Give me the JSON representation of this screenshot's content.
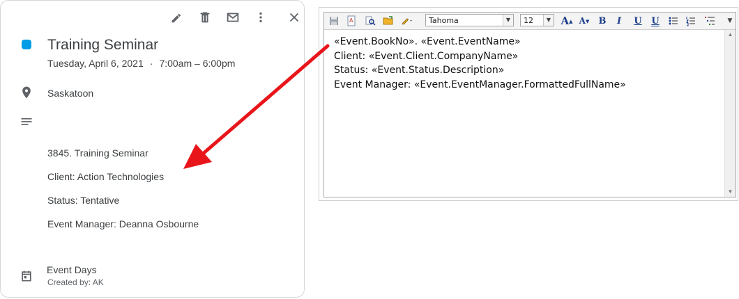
{
  "event": {
    "title": "Training Seminar",
    "date": "Tuesday, April 6, 2021",
    "separator": "·",
    "time": "7:00am – 6:00pm",
    "location": "Saskatoon",
    "color": "#039be5",
    "description": [
      "3845. Training Seminar",
      "Client: Action Technologies",
      "Status: Tentative",
      "Event Manager: Deanna Osbourne"
    ],
    "calendar": "Event Days",
    "created_by": "Created by: AK"
  },
  "card_toolbar": {
    "icons": [
      "edit-icon",
      "delete-icon",
      "email-icon",
      "more-options-icon",
      "close-icon"
    ]
  },
  "editor": {
    "font": "Tahoma",
    "font_size": "12",
    "toolbar_icons": [
      "save-icon",
      "spellcheck-icon",
      "find-icon",
      "open-icon",
      "insert-field-icon",
      "grow-font-icon",
      "shrink-font-icon",
      "bold-icon",
      "italic-icon",
      "underline-icon",
      "double-underline-icon",
      "bullets-icon",
      "numbering-icon",
      "multilevel-list-icon"
    ],
    "lines": [
      "«Event.BookNo». «Event.EventName»",
      "Client: «Event.Client.CompanyName»",
      "Status: «Event.Status.Description»",
      "Event Manager: «Event.EventManager.FormattedFullName»"
    ]
  },
  "annotation": {
    "arrow_color": "#e8161b"
  }
}
